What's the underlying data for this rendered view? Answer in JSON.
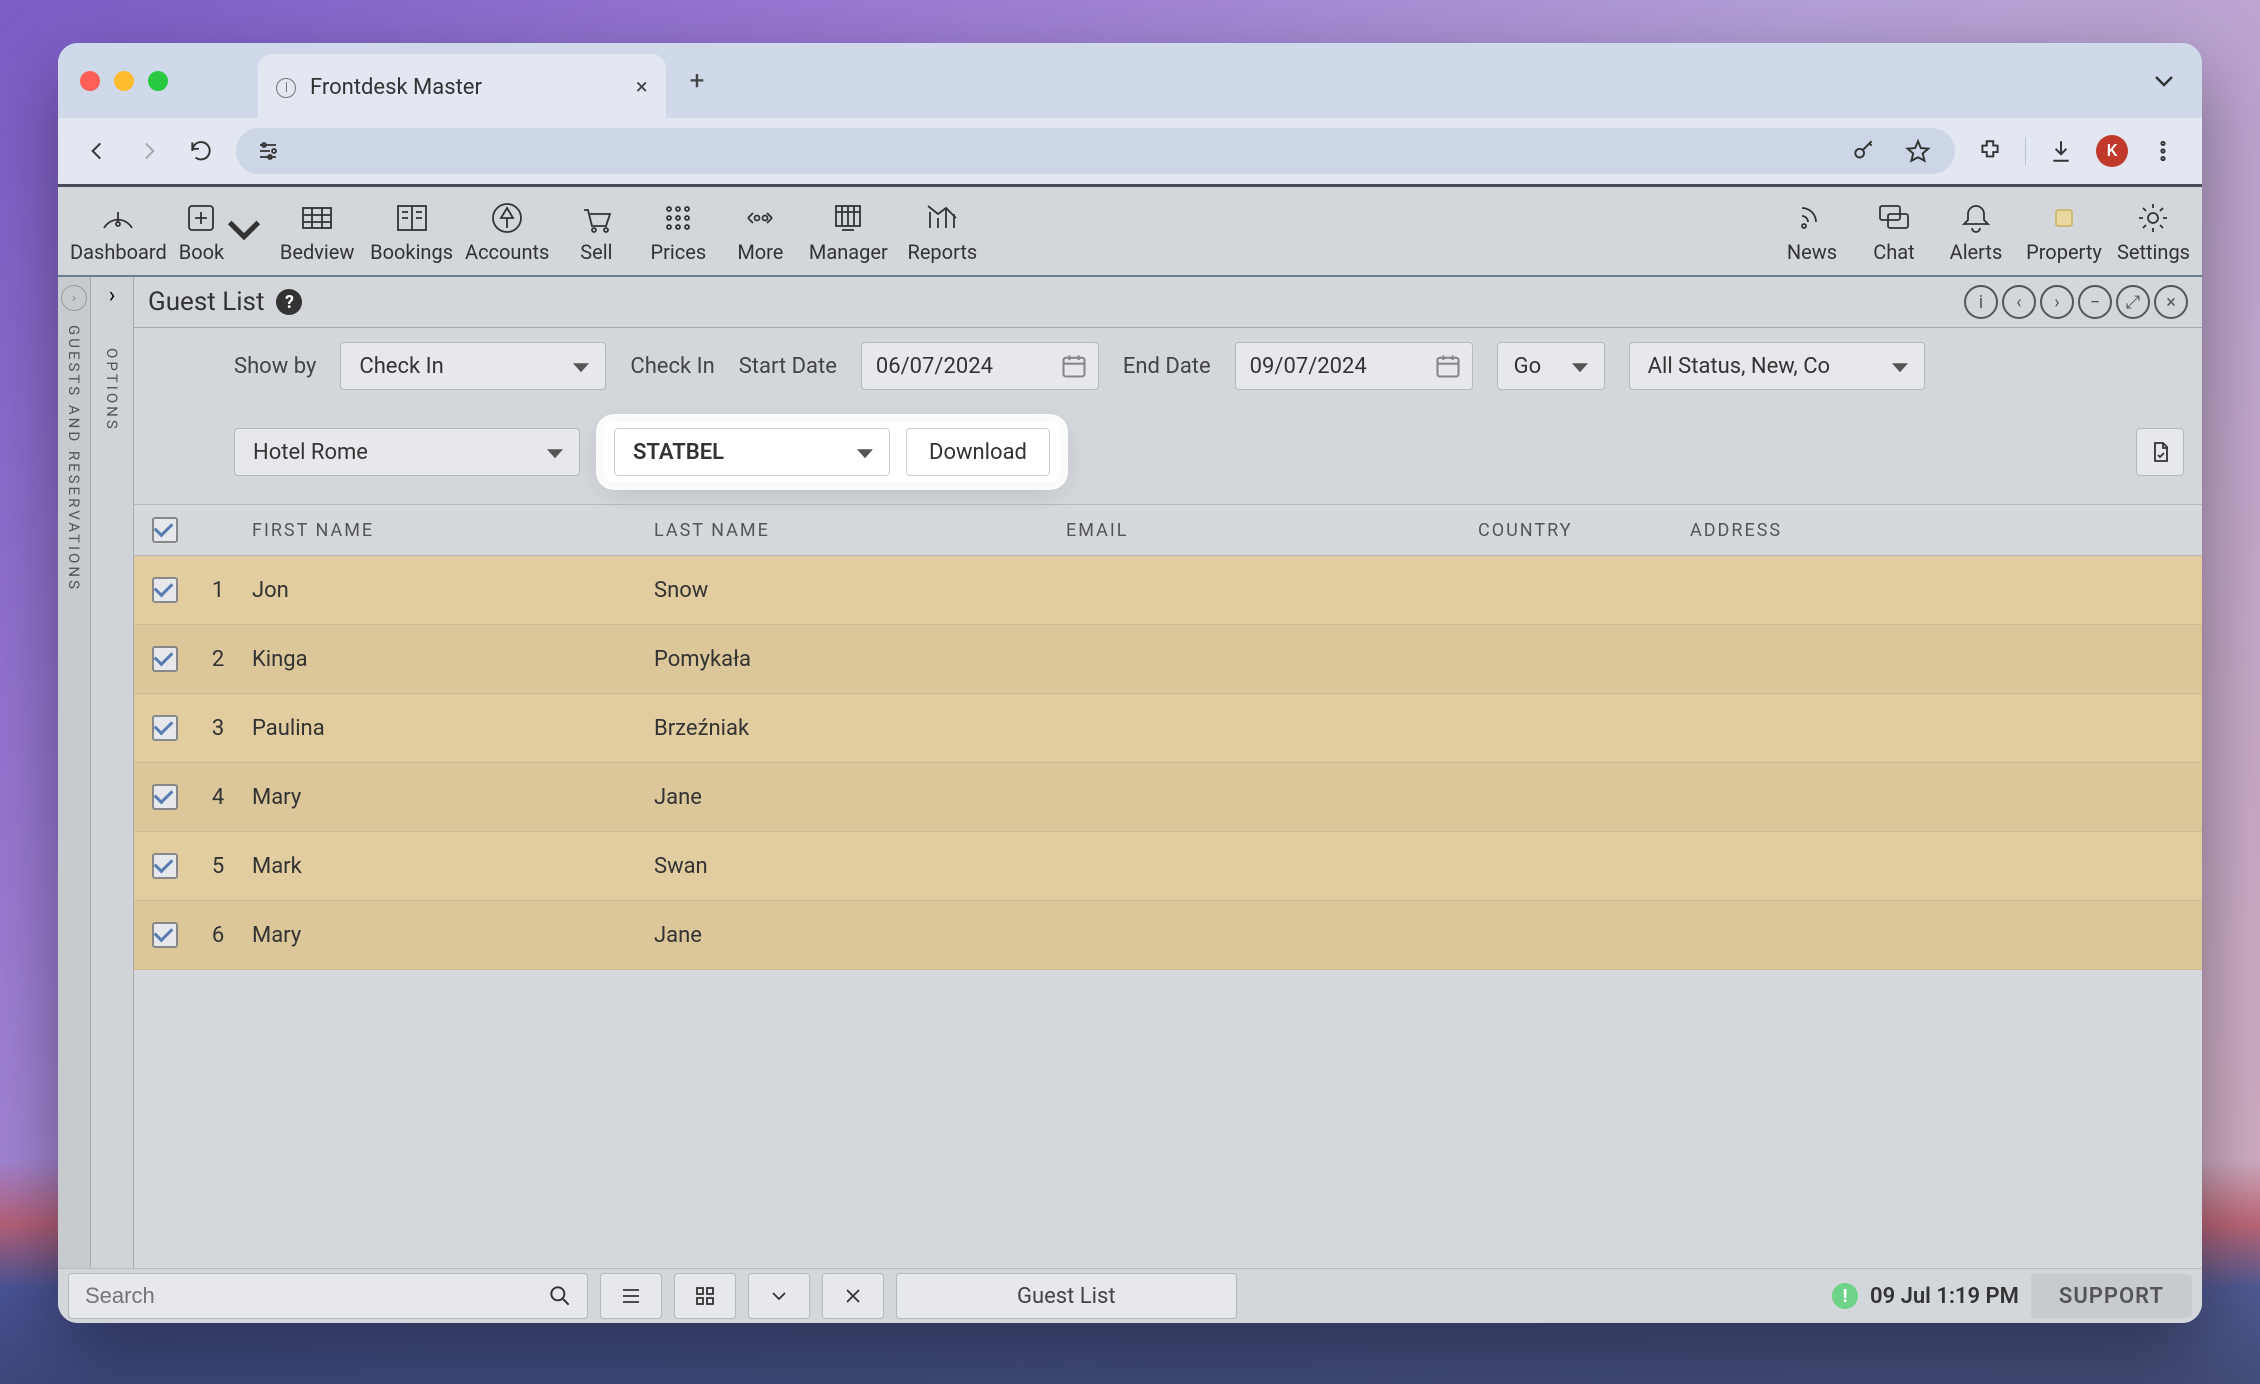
{
  "browser": {
    "tab_title": "Frontdesk Master",
    "avatar_initial": "K"
  },
  "toolbar": {
    "items": [
      "Dashboard",
      "Book",
      "Bedview",
      "Bookings",
      "Accounts",
      "Sell",
      "Prices",
      "More",
      "Manager",
      "Reports"
    ],
    "right_items": [
      "News",
      "Chat",
      "Alerts",
      "Property",
      "Settings"
    ]
  },
  "side_rails": {
    "left1": "GUESTS AND RESERVATIONS",
    "left2": "OPTIONS"
  },
  "panel": {
    "title": "Guest List"
  },
  "filters": {
    "show_by_label": "Show by",
    "show_by_value": "Check In",
    "check_in_label": "Check In",
    "start_date_label": "Start Date",
    "start_date_value": "06/07/2024",
    "end_date_label": "End Date",
    "end_date_value": "09/07/2024",
    "go_label": "Go",
    "status_value": "All Status, New, Co",
    "hotel_value": "Hotel Rome",
    "format_value": "STATBEL",
    "download_label": "Download"
  },
  "table": {
    "headers": {
      "first": "FIRST NAME",
      "last": "LAST NAME",
      "email": "EMAIL",
      "country": "COUNTRY",
      "address": "ADDRESS"
    },
    "rows": [
      {
        "idx": "1",
        "first": "Jon",
        "last": "Snow",
        "email": "",
        "country": "",
        "address": ""
      },
      {
        "idx": "2",
        "first": "Kinga",
        "last": "Pomykała",
        "email": "",
        "country": "",
        "address": ""
      },
      {
        "idx": "3",
        "first": "Paulina",
        "last": "Brzeźniak",
        "email": "",
        "country": "",
        "address": ""
      },
      {
        "idx": "4",
        "first": "Mary",
        "last": "Jane",
        "email": "",
        "country": "",
        "address": ""
      },
      {
        "idx": "5",
        "first": "Mark",
        "last": "Swan",
        "email": "",
        "country": "",
        "address": ""
      },
      {
        "idx": "6",
        "first": "Mary",
        "last": "Jane",
        "email": "",
        "country": "",
        "address": ""
      }
    ]
  },
  "bottom": {
    "search_placeholder": "Search",
    "tag": "Guest List",
    "datetime": "09 Jul 1:19 PM",
    "support": "SUPPORT"
  }
}
